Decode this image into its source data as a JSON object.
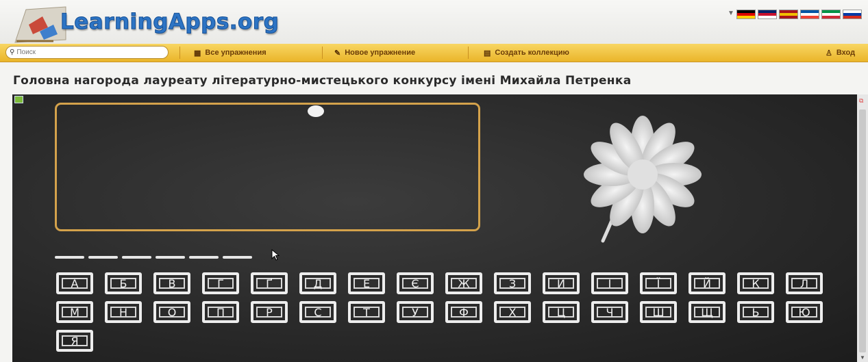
{
  "header": {
    "logo_text": "LearningApps.org",
    "flags": [
      {
        "name": "german-flag-icon",
        "colors": [
          "#000000",
          "#dd0000",
          "#ffce00"
        ]
      },
      {
        "name": "uk-flag-icon",
        "colors": [
          "#012169",
          "#c8102e",
          "#ffffff"
        ]
      },
      {
        "name": "spanish-flag-icon",
        "colors": [
          "#aa151b",
          "#f1bf00",
          "#aa151b"
        ]
      },
      {
        "name": "french-flag-icon",
        "colors": [
          "#0055a4",
          "#ffffff",
          "#ef4135"
        ]
      },
      {
        "name": "italian-flag-icon",
        "colors": [
          "#009246",
          "#ffffff",
          "#ce2b37"
        ]
      },
      {
        "name": "russian-flag-icon",
        "colors": [
          "#ffffff",
          "#0039a6",
          "#d52b1e"
        ]
      }
    ]
  },
  "toolbar": {
    "search_placeholder": "Поиск",
    "all_exercises": "Все упражнения",
    "new_exercise": "Новое упражнение",
    "create_collection": "Создать коллекцию",
    "login": "Вход"
  },
  "page": {
    "title": "Головна нагорода лауреату літературно-мистецького конкурсу імені Михайла Петренка"
  },
  "game": {
    "blanks_count": 6,
    "letters": [
      "А",
      "Б",
      "В",
      "Г",
      "Ґ",
      "Д",
      "Е",
      "Є",
      "Ж",
      "З",
      "И",
      "І",
      "Ї",
      "Й",
      "К",
      "Л",
      "М",
      "Н",
      "О",
      "П",
      "Р",
      "С",
      "Т",
      "У",
      "Ф",
      "Х",
      "Ц",
      "Ч",
      "Ш",
      "Щ",
      "Ь",
      "Ю",
      "Я"
    ]
  },
  "colors": {
    "toolbar": "#eab52a",
    "board": "#2a2a2a",
    "frame": "#d4a24b",
    "logo": "#2d74c4"
  }
}
